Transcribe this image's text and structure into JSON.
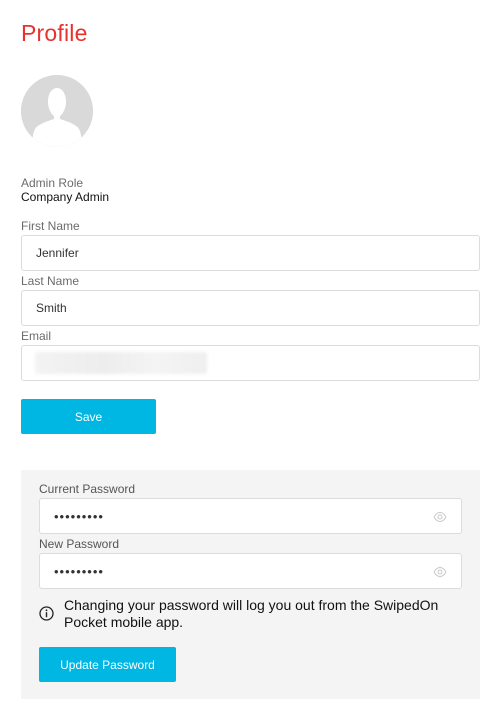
{
  "page": {
    "title": "Profile"
  },
  "profile": {
    "avatar_icon": "user-silhouette-icon",
    "role_label": "Admin Role",
    "role_value": "Company Admin"
  },
  "fields": {
    "first_name": {
      "label": "First Name",
      "value": "Jennifer"
    },
    "last_name": {
      "label": "Last Name",
      "value": "Smith"
    },
    "email": {
      "label": "Email",
      "value": ""
    }
  },
  "actions": {
    "save_label": "Save"
  },
  "password": {
    "current_label": "Current Password",
    "current_value": "•••••••••",
    "new_label": "New Password",
    "new_value": "•••••••••",
    "toggle_icon": "eye-icon",
    "info_icon": "info-icon",
    "info_text": "Changing your password will log you out from the SwipedOn Pocket mobile app.",
    "update_label": "Update Password"
  },
  "colors": {
    "title": "#e8322d",
    "button": "#00b6e3",
    "panel_bg": "#f4f4f4",
    "field_border": "#dcdcdc"
  }
}
